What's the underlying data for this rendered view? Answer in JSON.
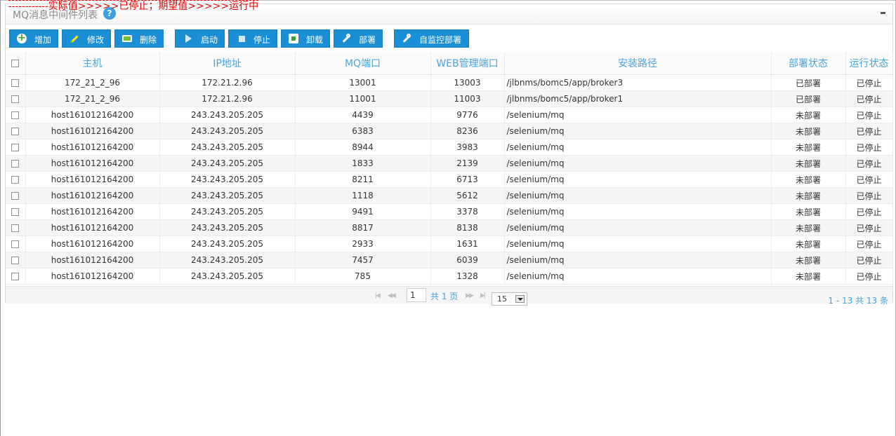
{
  "panel": {
    "title": "MQ消息中间件列表",
    "help_glyph": "?",
    "validation_message": "------------实际值>>>>>已停止；期望值>>>>>运行中"
  },
  "toolbar": {
    "add": "增加",
    "edit": "修改",
    "delete": "删除",
    "start": "启动",
    "stop": "停止",
    "uninstall": "卸载",
    "deploy": "部署",
    "self_monitor_deploy": "自监控部署"
  },
  "table": {
    "headers": [
      "主机",
      "IP地址",
      "MQ端口",
      "WEB管理端口",
      "安装路径",
      "部署状态",
      "运行状态"
    ],
    "rows": [
      {
        "host": "172_21_2_96",
        "ip": "172.21.2.96",
        "mq_port": "13001",
        "web_port": "13003",
        "path": "/jlbnms/bomc5/app/broker3",
        "deploy_status": "已部署",
        "run_status": "已停止"
      },
      {
        "host": "172_21_2_96",
        "ip": "172.21.2.96",
        "mq_port": "11001",
        "web_port": "11003",
        "path": "/jlbnms/bomc5/app/broker1",
        "deploy_status": "已部署",
        "run_status": "已停止"
      },
      {
        "host": "host161012164200",
        "ip": "243.243.205.205",
        "mq_port": "4439",
        "web_port": "9776",
        "path": "/selenium/mq",
        "deploy_status": "未部署",
        "run_status": "已停止"
      },
      {
        "host": "host161012164200",
        "ip": "243.243.205.205",
        "mq_port": "6383",
        "web_port": "8236",
        "path": "/selenium/mq",
        "deploy_status": "未部署",
        "run_status": "已停止"
      },
      {
        "host": "host161012164200",
        "ip": "243.243.205.205",
        "mq_port": "8944",
        "web_port": "3983",
        "path": "/selenium/mq",
        "deploy_status": "未部署",
        "run_status": "已停止"
      },
      {
        "host": "host161012164200",
        "ip": "243.243.205.205",
        "mq_port": "1833",
        "web_port": "2139",
        "path": "/selenium/mq",
        "deploy_status": "未部署",
        "run_status": "已停止"
      },
      {
        "host": "host161012164200",
        "ip": "243.243.205.205",
        "mq_port": "8211",
        "web_port": "6713",
        "path": "/selenium/mq",
        "deploy_status": "未部署",
        "run_status": "已停止"
      },
      {
        "host": "host161012164200",
        "ip": "243.243.205.205",
        "mq_port": "1118",
        "web_port": "5612",
        "path": "/selenium/mq",
        "deploy_status": "未部署",
        "run_status": "已停止"
      },
      {
        "host": "host161012164200",
        "ip": "243.243.205.205",
        "mq_port": "9491",
        "web_port": "3378",
        "path": "/selenium/mq",
        "deploy_status": "未部署",
        "run_status": "已停止"
      },
      {
        "host": "host161012164200",
        "ip": "243.243.205.205",
        "mq_port": "8817",
        "web_port": "8138",
        "path": "/selenium/mq",
        "deploy_status": "未部署",
        "run_status": "已停止"
      },
      {
        "host": "host161012164200",
        "ip": "243.243.205.205",
        "mq_port": "2933",
        "web_port": "1631",
        "path": "/selenium/mq",
        "deploy_status": "未部署",
        "run_status": "已停止"
      },
      {
        "host": "host161012164200",
        "ip": "243.243.205.205",
        "mq_port": "7457",
        "web_port": "6039",
        "path": "/selenium/mq",
        "deploy_status": "未部署",
        "run_status": "已停止"
      },
      {
        "host": "host161012164200",
        "ip": "243.243.205.205",
        "mq_port": "785",
        "web_port": "1328",
        "path": "/selenium/mq",
        "deploy_status": "未部署",
        "run_status": "已停止"
      }
    ]
  },
  "pager": {
    "current_page": "1",
    "total_pages_text": "共 1 页",
    "page_size": "15",
    "range_text": "1 - 13    共 13 条"
  },
  "colors": {
    "accent": "#1a8fd5",
    "header_text": "#4aa3da",
    "status_deployed": "#008a00",
    "status_bad": "#e00000"
  }
}
